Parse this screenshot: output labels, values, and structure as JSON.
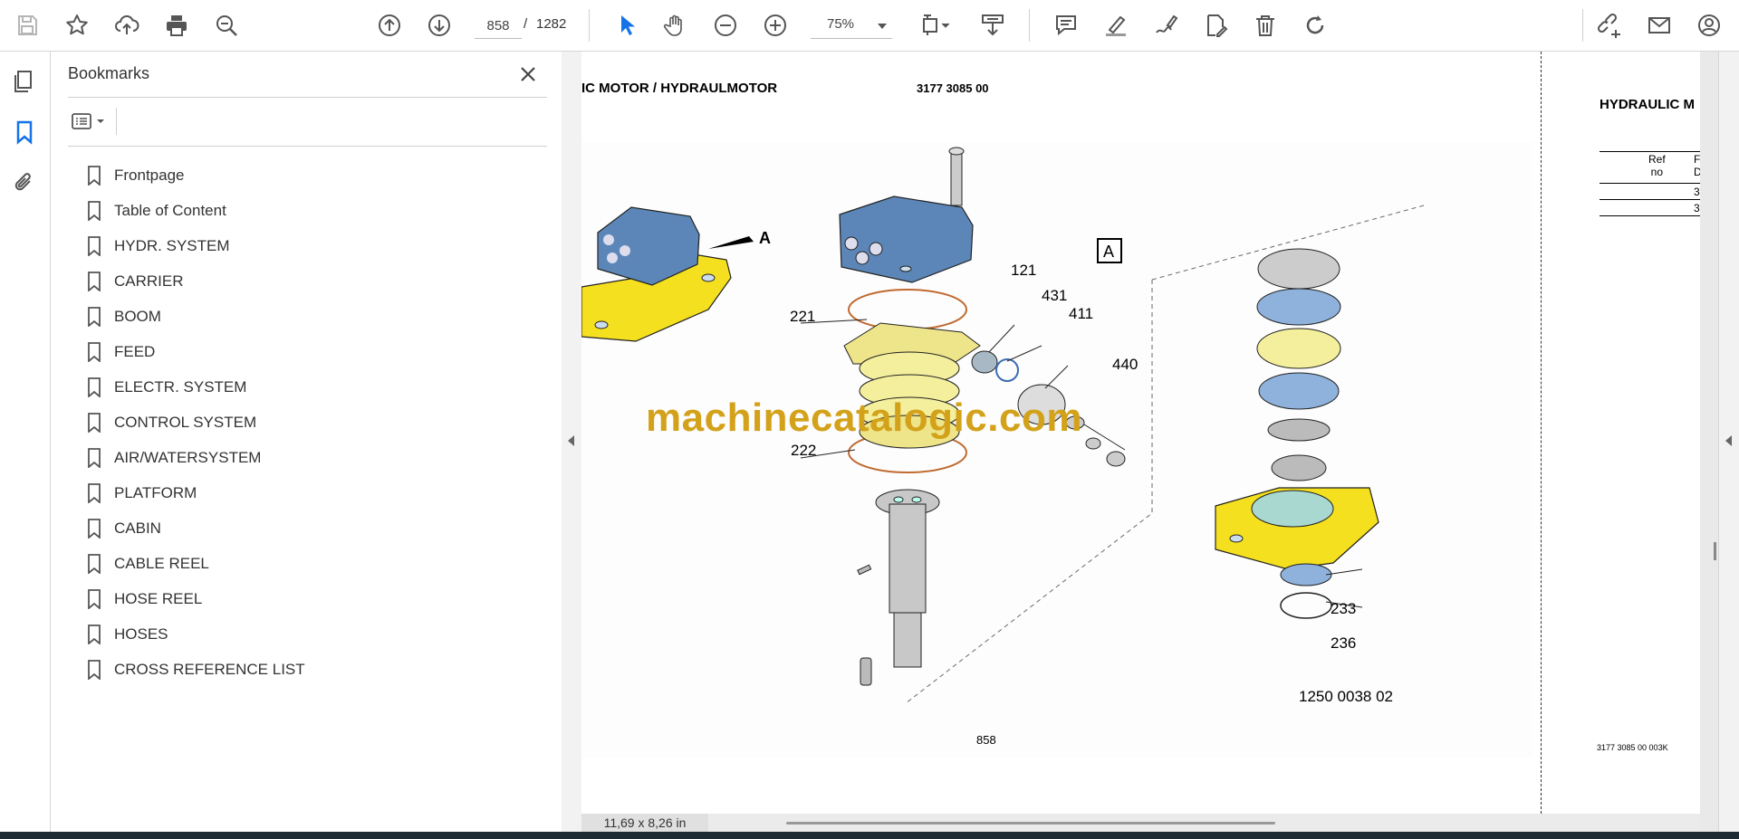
{
  "toolbar": {
    "page_current": "858",
    "page_sep": "/",
    "page_total": "1282",
    "zoom": "75%",
    "icons": [
      "save-icon",
      "star-icon",
      "upload-icon",
      "print-icon",
      "find-icon",
      "prev-page-icon",
      "next-page-icon",
      "select-icon",
      "hand-icon",
      "zoom-out-icon",
      "zoom-in-icon",
      "fit-page-icon",
      "scroll-mode-icon",
      "comment-icon",
      "highlight-icon",
      "sign-icon",
      "fill-sign-icon",
      "delete-icon",
      "rotate-icon",
      "share-link-icon",
      "email-icon",
      "account-icon"
    ]
  },
  "bookmarks": {
    "title": "Bookmarks",
    "items": [
      {
        "label": "Frontpage"
      },
      {
        "label": "Table of Content"
      },
      {
        "label": "HYDR. SYSTEM"
      },
      {
        "label": "CARRIER"
      },
      {
        "label": "BOOM"
      },
      {
        "label": "FEED"
      },
      {
        "label": "ELECTR. SYSTEM"
      },
      {
        "label": "CONTROL SYSTEM"
      },
      {
        "label": "AIR/WATERSYSTEM"
      },
      {
        "label": "PLATFORM"
      },
      {
        "label": "CABIN"
      },
      {
        "label": "CABLE REEL"
      },
      {
        "label": "HOSE REEL"
      },
      {
        "label": "HOSES"
      },
      {
        "label": "CROSS REFERENCE LIST"
      }
    ]
  },
  "document": {
    "header_left": "IC MOTOR / HYDRAULMOTOR",
    "header_code": "3177 3085 00",
    "header_right": "HYDRAULIC M",
    "table_ref": "Ref",
    "table_no": "no",
    "table_cut_1": "F",
    "table_cut_2": "D",
    "table_cut_3": "3",
    "table_cut_4": "3",
    "view_label": "A",
    "detail_label": "A",
    "callouts": {
      "c121": "121",
      "c431": "431",
      "c411": "411",
      "c440": "440",
      "c221": "221",
      "c222": "222",
      "c233": "233",
      "c236": "236"
    },
    "drawing_number": "1250 0038 02",
    "page_number": "858",
    "footer_right": "3177 3085 00  003K",
    "watermark": "machinecatalogic.com",
    "page_size": "11,69 x 8,26 in"
  },
  "colors": {
    "part_blue": "#5b86b7",
    "part_yellow": "#f5e020",
    "watermark": "#d3a21a",
    "accent": "#1473e6"
  }
}
